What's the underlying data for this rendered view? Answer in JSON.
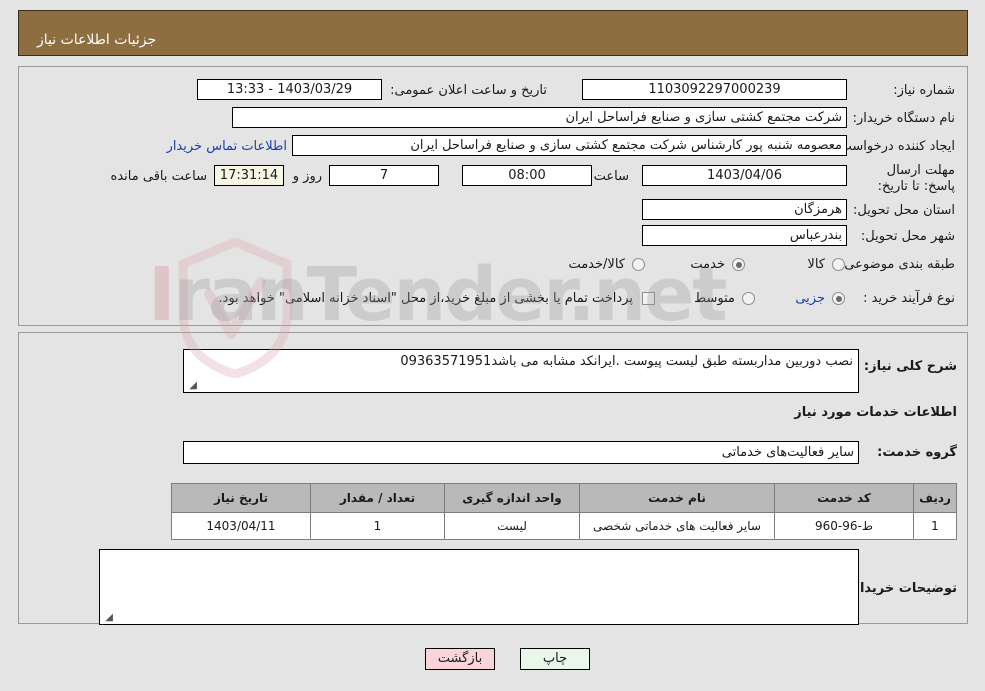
{
  "header": {
    "title": "جزئیات اطلاعات نیاز",
    "bg_color": "#8d6e41"
  },
  "watermark": {
    "text_left": "IranTender",
    "text_right": ".net",
    "glyph": "shield-icon"
  },
  "need_info": {
    "need_number_label": "شماره نیاز:",
    "need_number_value": "1103092297000239",
    "announce_label": "تاریخ و ساعت اعلان عمومی:",
    "announce_value": "1403/03/29 - 13:33",
    "buyer_org_label": "نام دستگاه خریدار:",
    "buyer_org_value": "شرکت مجتمع کشتی سازی و صنایع فراساحل ایران",
    "creator_label": "ایجاد کننده درخواست:",
    "creator_value": "معصومه شنبه پور کارشناس شرکت مجتمع کشتی سازی و صنایع فراساحل ایران",
    "contact_link": "اطلاعات تماس خریدار",
    "deadline_label": "مهلت ارسال پاسخ: تا تاریخ:",
    "deadline_value": "1403/04/06",
    "hour_label": "ساعت",
    "hour_value": "08:00",
    "days_value": "7",
    "days_label": "روز و",
    "countdown_value": "17:31:14",
    "countdown_label": "ساعت باقی مانده",
    "province_label": "استان محل تحویل:",
    "province_value": "هرمزگان",
    "city_label": "شهر محل تحویل:",
    "city_value": "بندرعباس",
    "category_label": "طبقه بندی موضوعی:",
    "category_options": [
      {
        "label": "کالا",
        "selected": false
      },
      {
        "label": "خدمت",
        "selected": true
      },
      {
        "label": "کالا/خدمت",
        "selected": false
      }
    ],
    "process_label": "نوع فرآیند خرید :",
    "process_options": [
      {
        "label": "جزیی",
        "selected": true
      },
      {
        "label": "متوسط",
        "selected": false
      }
    ],
    "treasury_checkbox_checked": false,
    "treasury_note": "پرداخت تمام یا بخشی از مبلغ خرید،از محل \"اسناد خزانه اسلامی\" خواهد بود."
  },
  "description": {
    "general_label": "شرح کلی نیاز:",
    "general_value": "نصب دوربین مداربسته طبق لیست پیوست .ایرانکد مشابه می باشد09363571951",
    "services_heading": "اطلاعات خدمات مورد نیاز",
    "service_group_label": "گروه خدمت:",
    "service_group_value": "سایر فعالیت‌های خدماتی",
    "buyer_notes_label": "توضیحات خریدار:",
    "buyer_notes_value": ""
  },
  "table": {
    "columns": [
      "ردیف",
      "کد خدمت",
      "نام خدمت",
      "واحد اندازه گیری",
      "تعداد / مقدار",
      "تاریخ نیاز"
    ],
    "rows": [
      {
        "row": "1",
        "service_code": "ط-96-960",
        "service_name": "سایر فعالیت های خدماتی شخصی",
        "unit": "لیست",
        "quantity": "1",
        "need_date": "1403/04/11"
      }
    ]
  },
  "footer": {
    "print_label": "چاپ",
    "back_label": "بازگشت"
  }
}
